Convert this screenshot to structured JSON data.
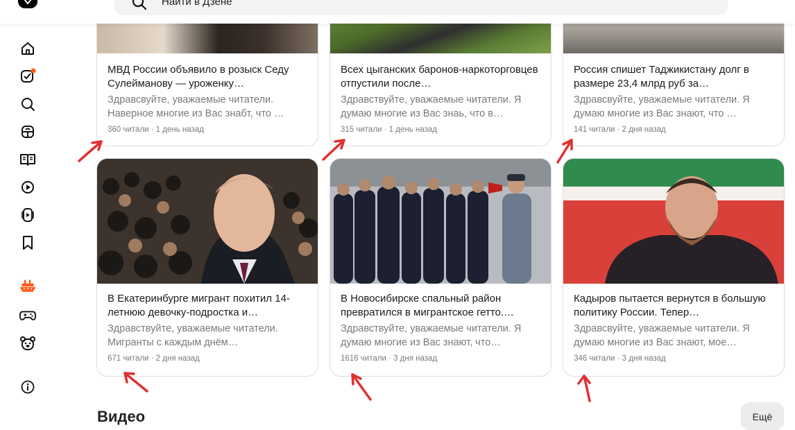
{
  "search": {
    "placeholder": "Найти в Дзене"
  },
  "sidebar": {
    "items": [
      {
        "icon": "home-icon"
      },
      {
        "icon": "subscriptions-icon",
        "badge": true
      },
      {
        "icon": "search-icon"
      },
      {
        "icon": "showcase-icon"
      },
      {
        "icon": "articles-icon"
      },
      {
        "icon": "video-icon"
      },
      {
        "icon": "shorts-icon"
      },
      {
        "icon": "bookmarks-icon"
      },
      {
        "icon": "ship-icon"
      },
      {
        "icon": "games-icon"
      },
      {
        "icon": "kids-icon"
      },
      {
        "icon": "info-icon"
      }
    ]
  },
  "cards": [
    {
      "title": "МВД России объявило в розыск Седу Сулейманову — уроженку…",
      "desc": "Здравсвуйте, уважаемые читатели. Наверное многие из Вас знабт, что …",
      "meta": "360 читали · 1 день назад"
    },
    {
      "title": "Всех цыганских баронов-наркоторговцев отпустили после…",
      "desc": "Здравствуйте, уважаемые читатели. Я думаю многие из Вас знаь, что в…",
      "meta": "315 читали · 1 день назад"
    },
    {
      "title": "Россия спишет Таджикистану долг в размере 23,4 млрд руб за…",
      "desc": "Здравсвуйте, уважаемые читатели. Я думаю многие из Вас знают, что …",
      "meta": "141 читали · 2 дня назад"
    },
    {
      "title": "В Екатеринбурге мигрант похитил 14-летнюю девочку-подростка и…",
      "desc": "Здравствуйте, уважаемые читатели. Мигранты с каждым днём…",
      "meta": "671 читали · 2 дня назад"
    },
    {
      "title": "В Новосибирске спальный район превратился в мигрантское гетто.…",
      "desc": "Здравствуйте, уважаемые читатели. Я думаю многие из Вас знают, что…",
      "meta": "1616 читали · 3 дня назад"
    },
    {
      "title": "Кадыров пытается вернутся в большую политику России. Тепер…",
      "desc": "Здравсвуйте, уважаемые читатели. Я думаю многие из Вас знают, мое…",
      "meta": "346 читали · 3 дня назад"
    }
  ],
  "section": {
    "title": "Видео",
    "more": "Ещё"
  },
  "colors": {
    "accent": "#ff5b1a",
    "arrow": "#e03030"
  }
}
